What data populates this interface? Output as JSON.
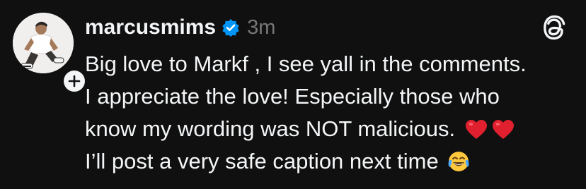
{
  "post": {
    "author": {
      "username": "marcusmims",
      "verified": true,
      "avatar_icon": "profile-photo",
      "follow_icon": "plus-icon"
    },
    "time_ago": "3m",
    "app_icon": "threads-logo-icon",
    "text_lines": [
      "Big love to Markf , I see yall in the comments.",
      "I appreciate the love! Especially those who",
      "know my wording was NOT malicious.",
      "I’ll post a very safe caption next time"
    ],
    "emojis": {
      "line3": [
        "red-heart-emoji",
        "red-heart-emoji"
      ],
      "line4": [
        "tears-of-joy-emoji"
      ]
    }
  },
  "colors": {
    "background": "#101010",
    "text": "#f3f5f7",
    "muted": "#777777",
    "verified_blue": "#0095f6",
    "heart_red": "#e0202e"
  }
}
